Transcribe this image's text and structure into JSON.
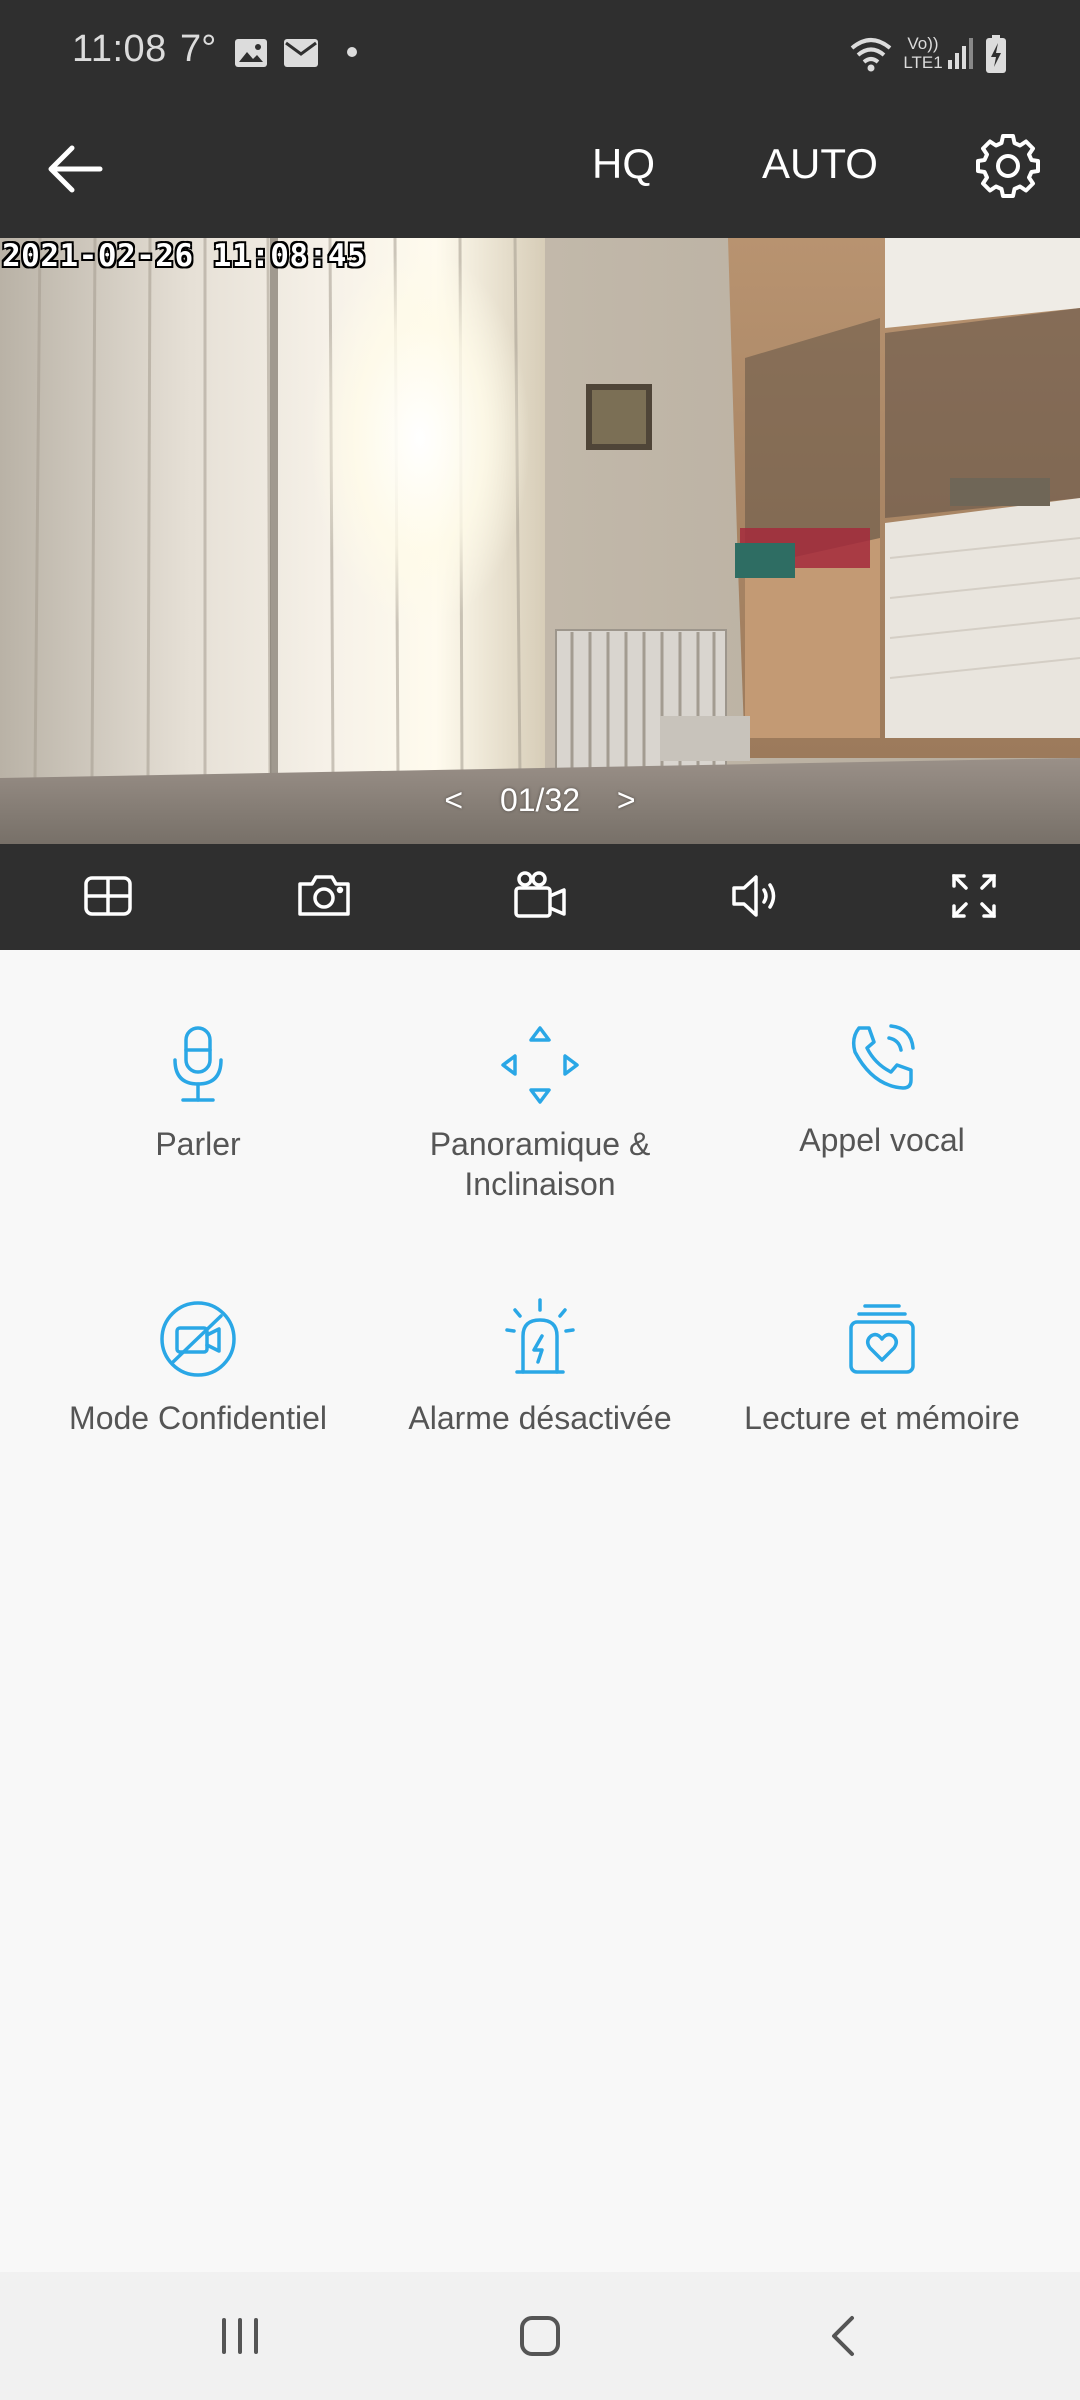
{
  "status_bar": {
    "time": "11:08",
    "temperature": "7°",
    "icons": [
      "image-icon",
      "mail-icon",
      "dot-icon",
      "wifi-icon",
      "volte-lte-icon",
      "signal-icon",
      "battery-charging-icon"
    ],
    "volte_label": "Vo)) LTE1"
  },
  "header": {
    "back_icon": "arrow-left-icon",
    "quality_label": "HQ",
    "mode_label": "AUTO",
    "settings_icon": "gear-icon"
  },
  "video": {
    "timestamp": "2021-02-26  11:08:45",
    "pager": {
      "prev": "<",
      "current": "01/32",
      "next": ">"
    }
  },
  "video_toolbar": {
    "icons": [
      "grid-view-icon",
      "camera-icon",
      "video-record-icon",
      "speaker-icon",
      "fullscreen-icon"
    ]
  },
  "features": [
    {
      "label": "Parler",
      "icon": "microphone-icon"
    },
    {
      "label": "Panoramique & Inclinaison",
      "label_line1": "Panoramique &",
      "label_line2": "Inclinaison",
      "icon": "pan-tilt-arrows-icon"
    },
    {
      "label": "Appel vocal",
      "icon": "phone-call-icon"
    },
    {
      "label": "Mode Confidentiel",
      "icon": "privacy-camera-off-icon"
    },
    {
      "label": "Alarme désactivée",
      "icon": "siren-icon"
    },
    {
      "label": "Lecture et mémoire",
      "icon": "playback-memory-icon"
    }
  ],
  "colors": {
    "accent": "#2aa7e6",
    "bar_background": "#2f2f2f",
    "page_background": "#f8f8f8",
    "label_text": "#555555"
  },
  "nav_bar": {
    "icons": [
      "recent-apps-icon",
      "home-icon",
      "back-icon"
    ]
  }
}
